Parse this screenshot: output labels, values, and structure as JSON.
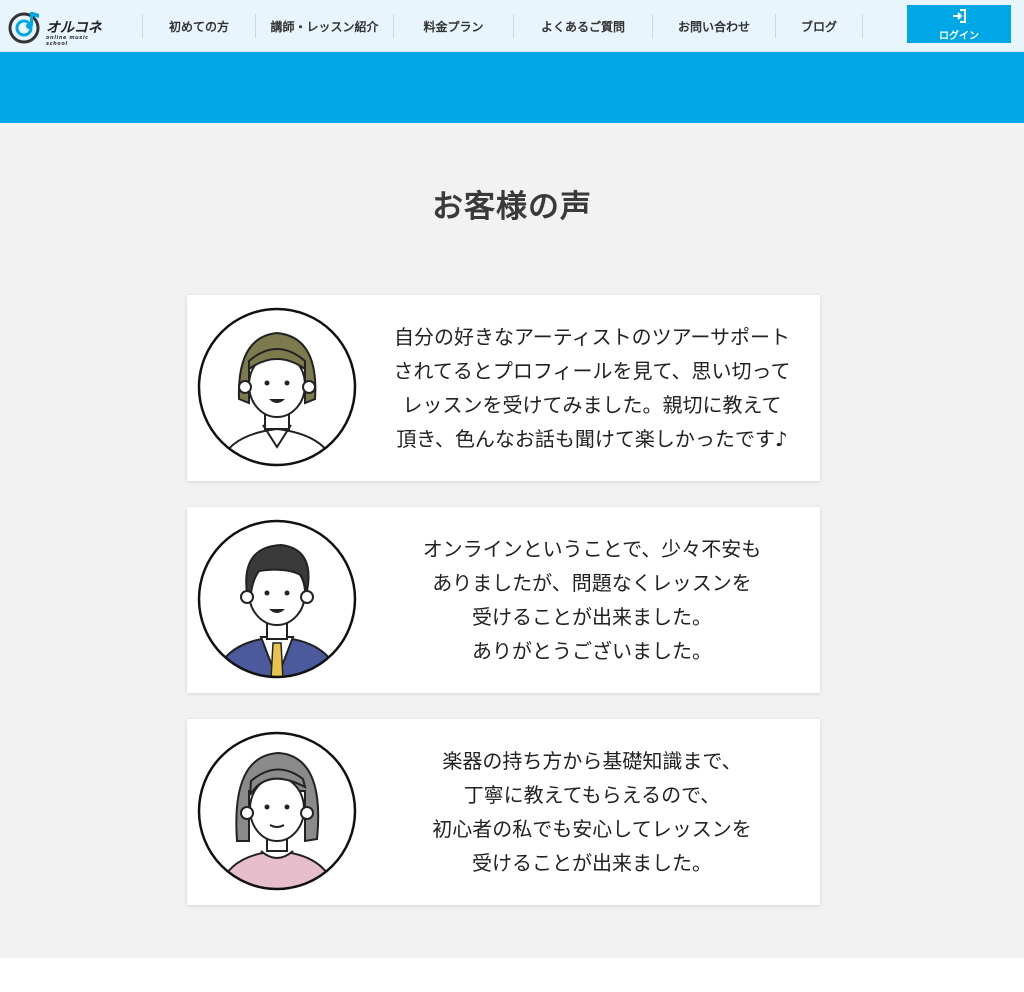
{
  "header": {
    "logo_text": "オルコネ",
    "logo_sub": "online music school",
    "nav": [
      "初めての方",
      "講師・レッスン紹介",
      "料金プラン",
      "よくあるご質問",
      "お問い合わせ",
      "ブログ"
    ],
    "login_label": "ログイン"
  },
  "section": {
    "title": "お客様の声",
    "testimonials": [
      {
        "lines": [
          "自分の好きなアーティストのツアーサポート",
          "されてるとプロフィールを見て、思い切って",
          "レッスンを受けてみました。親切に教えて",
          "頂き、色んなお話も聞けて楽しかったです♪"
        ]
      },
      {
        "lines": [
          "オンラインということで、少々不安も",
          "ありましたが、問題なくレッスンを",
          "受けることが出来ました。",
          "ありがとうございました。"
        ]
      },
      {
        "lines": [
          "楽器の持ち方から基礎知識まで、",
          "丁寧に教えてもらえるので、",
          "初心者の私でも安心してレッスンを",
          "受けることが出来ました。"
        ]
      }
    ]
  },
  "colors": {
    "accent": "#00a7e6",
    "header_bg": "#e9f5fc",
    "section_bg": "#f2f2f2"
  }
}
